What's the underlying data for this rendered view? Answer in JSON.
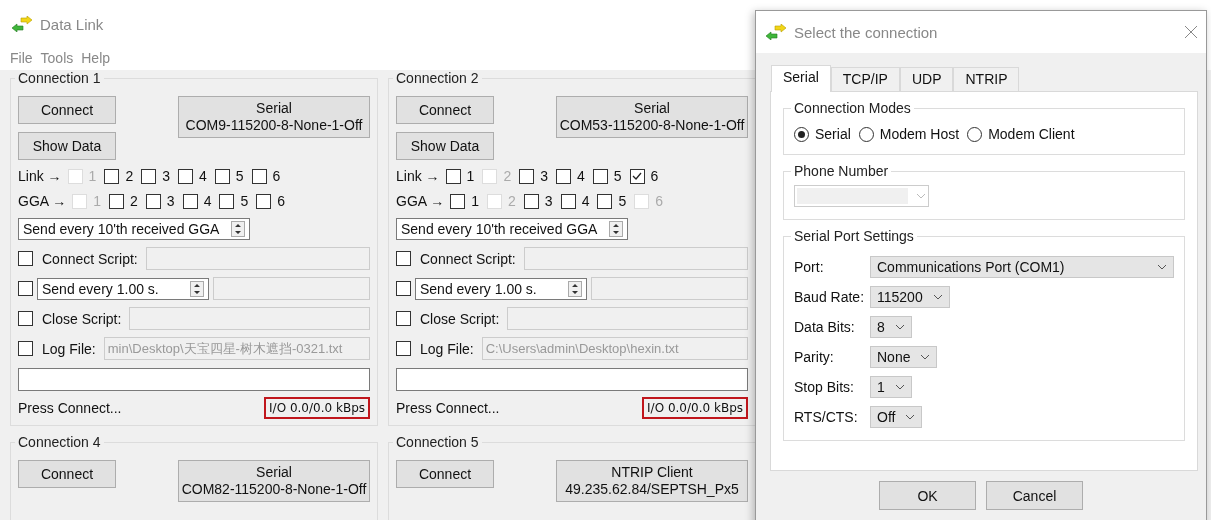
{
  "app": {
    "title": "Data Link",
    "menu": [
      "File",
      "Tools",
      "Help"
    ]
  },
  "connections": [
    {
      "title": "Connection 1",
      "connect": "Connect",
      "type_label": "Serial",
      "type_detail": "COM9-115200-8-None-1-Off",
      "show_data": "Show Data",
      "link": {
        "label": "Link →",
        "boxes": [
          {
            "label": "1",
            "checked": false,
            "disabled": true
          },
          {
            "label": "2",
            "checked": false,
            "disabled": false
          },
          {
            "label": "3",
            "checked": false,
            "disabled": false
          },
          {
            "label": "4",
            "checked": false,
            "disabled": false
          },
          {
            "label": "5",
            "checked": false,
            "disabled": false
          },
          {
            "label": "6",
            "checked": false,
            "disabled": false
          }
        ]
      },
      "gga": {
        "label": "GGA →",
        "boxes": [
          {
            "label": "1",
            "checked": false,
            "disabled": true
          },
          {
            "label": "2",
            "checked": false,
            "disabled": false
          },
          {
            "label": "3",
            "checked": false,
            "disabled": false
          },
          {
            "label": "4",
            "checked": false,
            "disabled": false
          },
          {
            "label": "5",
            "checked": false,
            "disabled": false
          },
          {
            "label": "6",
            "checked": false,
            "disabled": false
          }
        ]
      },
      "gga_rate": "Send every 10'th received GGA",
      "connect_script": {
        "label": "Connect Script:",
        "checked": false
      },
      "send": {
        "value": "Send every 1.00 s.",
        "checked": false
      },
      "close_script": {
        "label": "Close Script:",
        "checked": false
      },
      "log_file": {
        "label": "Log File:",
        "checked": false,
        "value": "min\\Desktop\\天宝四星-树木遮挡-0321.txt"
      },
      "status": "Press Connect...",
      "io": "I/O 0.0/0.0 kBps"
    },
    {
      "title": "Connection 2",
      "connect": "Connect",
      "type_label": "Serial",
      "type_detail": "COM53-115200-8-None-1-Off",
      "show_data": "Show Data",
      "link": {
        "label": "Link →",
        "boxes": [
          {
            "label": "1",
            "checked": false,
            "disabled": false
          },
          {
            "label": "2",
            "checked": false,
            "disabled": true
          },
          {
            "label": "3",
            "checked": false,
            "disabled": false
          },
          {
            "label": "4",
            "checked": false,
            "disabled": false
          },
          {
            "label": "5",
            "checked": false,
            "disabled": false
          },
          {
            "label": "6",
            "checked": true,
            "disabled": false
          }
        ]
      },
      "gga": {
        "label": "GGA →",
        "boxes": [
          {
            "label": "1",
            "checked": false,
            "disabled": false
          },
          {
            "label": "2",
            "checked": false,
            "disabled": true
          },
          {
            "label": "3",
            "checked": false,
            "disabled": false
          },
          {
            "label": "4",
            "checked": false,
            "disabled": false
          },
          {
            "label": "5",
            "checked": false,
            "disabled": false
          },
          {
            "label": "6",
            "checked": false,
            "disabled": true
          }
        ]
      },
      "gga_rate": "Send every 10'th received GGA",
      "connect_script": {
        "label": "Connect Script:",
        "checked": false
      },
      "send": {
        "value": "Send every 1.00 s.",
        "checked": false
      },
      "close_script": {
        "label": "Close Script:",
        "checked": false
      },
      "log_file": {
        "label": "Log File:",
        "checked": false,
        "value": "C:\\Users\\admin\\Desktop\\hexin.txt"
      },
      "status": "Press Connect...",
      "io": "I/O 0.0/0.0 kBps"
    },
    {
      "title": "Connection 4",
      "connect": "Connect",
      "type_label": "Serial",
      "type_detail": "COM82-115200-8-None-1-Off"
    },
    {
      "title": "Connection 5",
      "connect": "Connect",
      "type_label": "NTRIP Client",
      "type_detail": "49.235.62.84/SEPTSH_Px5"
    }
  ],
  "dialog": {
    "title": "Select the connection",
    "tabs": [
      {
        "label": "Serial",
        "selected": true
      },
      {
        "label": "TCP/IP",
        "selected": false
      },
      {
        "label": "UDP",
        "selected": false
      },
      {
        "label": "NTRIP",
        "selected": false
      }
    ],
    "modes": {
      "title": "Connection Modes",
      "options": [
        {
          "label": "Serial",
          "selected": true
        },
        {
          "label": "Modem Host",
          "selected": false
        },
        {
          "label": "Modem Client",
          "selected": false
        }
      ]
    },
    "phone": {
      "title": "Phone Number",
      "disabled": true
    },
    "serial_settings": {
      "title": "Serial Port Settings",
      "fields": [
        {
          "label": "Port:",
          "value": "Communications Port (COM1)",
          "kind": "wide"
        },
        {
          "label": "Baud Rate:",
          "value": "115200",
          "kind": "compact"
        },
        {
          "label": "Data Bits:",
          "value": "8",
          "kind": "compact"
        },
        {
          "label": "Parity:",
          "value": "None",
          "kind": "compact"
        },
        {
          "label": "Stop Bits:",
          "value": "1",
          "kind": "compact"
        },
        {
          "label": "RTS/CTS:",
          "value": "Off",
          "kind": "compact"
        }
      ]
    },
    "buttons": [
      "OK",
      "Cancel"
    ]
  }
}
